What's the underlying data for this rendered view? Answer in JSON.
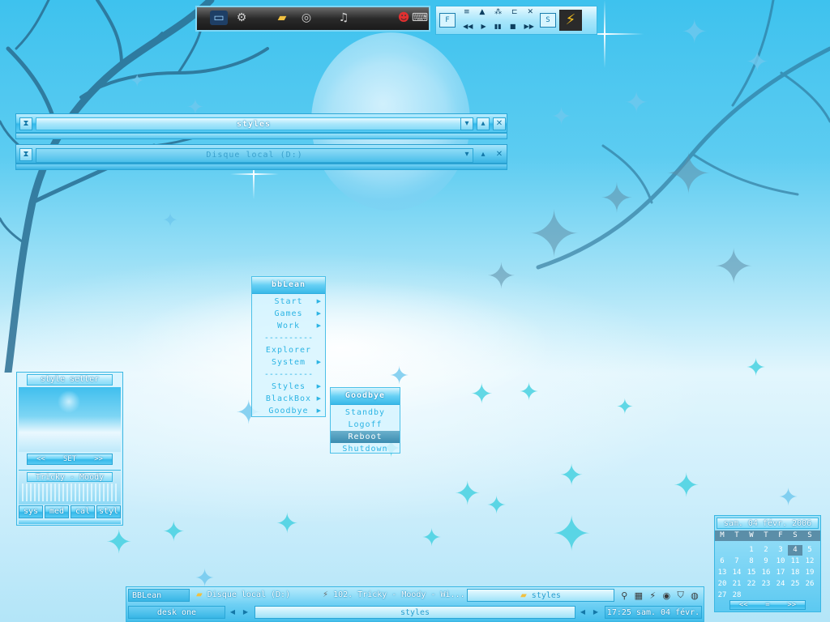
{
  "toolbar": {
    "icons": [
      "monitor-icon",
      "gear-icon",
      "folder-icon",
      "disc-icon",
      "media-icon",
      "mario-icon",
      "keyboard-icon"
    ],
    "media": {
      "f_label": "F",
      "s_label": "S",
      "controls_top": [
        "≡",
        "▲",
        "⁂",
        "⊏",
        "✕"
      ],
      "controls_bottom": [
        "◀◀",
        "▶",
        "▮▮",
        "■",
        "▶▶"
      ]
    }
  },
  "windows": [
    {
      "title": "styles"
    },
    {
      "title": "Disque local (D:)"
    }
  ],
  "menu": {
    "title": "bbLean",
    "items": [
      {
        "label": "Start",
        "submenu": true
      },
      {
        "label": "Games",
        "submenu": true
      },
      {
        "label": "Work",
        "submenu": true
      },
      {
        "label": "----------",
        "separator": true
      },
      {
        "label": "Explorer",
        "submenu": false
      },
      {
        "label": "System",
        "submenu": true
      },
      {
        "label": "----------",
        "separator": true
      },
      {
        "label": "Styles",
        "submenu": true
      },
      {
        "label": "BlackBox",
        "submenu": true
      },
      {
        "label": "Goodbye",
        "submenu": true
      }
    ]
  },
  "submenu": {
    "title": "Goodbye",
    "items": [
      {
        "label": "Standby"
      },
      {
        "label": "Logoff"
      },
      {
        "label": "Reboot",
        "selected": true
      },
      {
        "label": "Shutdown"
      }
    ]
  },
  "style_setter": {
    "title": "style setter",
    "prev": "<<",
    "set": "SET",
    "next": ">>",
    "style_name": "Tricky - Moody",
    "tabs": [
      "sys",
      "med",
      "cal",
      "styl"
    ]
  },
  "calendar": {
    "header": "sam. 04 févr. 2006",
    "days": [
      "M",
      "T",
      "W",
      "T",
      "F",
      "S",
      "S"
    ],
    "rows": [
      [
        "",
        "",
        "1",
        "2",
        "3",
        "4",
        "5"
      ],
      [
        "6",
        "7",
        "8",
        "9",
        "10",
        "11",
        "12"
      ],
      [
        "13",
        "14",
        "15",
        "16",
        "17",
        "18",
        "19"
      ],
      [
        "20",
        "21",
        "22",
        "23",
        "24",
        "25",
        "26"
      ],
      [
        "27",
        "28",
        "",
        "",
        "",
        "",
        ""
      ]
    ],
    "today": "4",
    "nav": [
      "<<",
      "=",
      ">>"
    ]
  },
  "taskbar": {
    "start_label": "BBLean",
    "tasks": [
      {
        "label": "Disque local (D:)",
        "icon": "folder-icon"
      },
      {
        "label": "102. Tricky - Moody - Wi...",
        "icon": "winamp-icon"
      },
      {
        "label": "styles",
        "icon": "folder-icon",
        "active": true
      }
    ],
    "workspace": "desk one",
    "window_label": "styles",
    "clock": "17:25 sam. 04 févr.",
    "tray_icons": [
      "network-icon",
      "display-icon",
      "power-icon",
      "wifi-icon",
      "shield-icon",
      "volume-icon"
    ]
  }
}
